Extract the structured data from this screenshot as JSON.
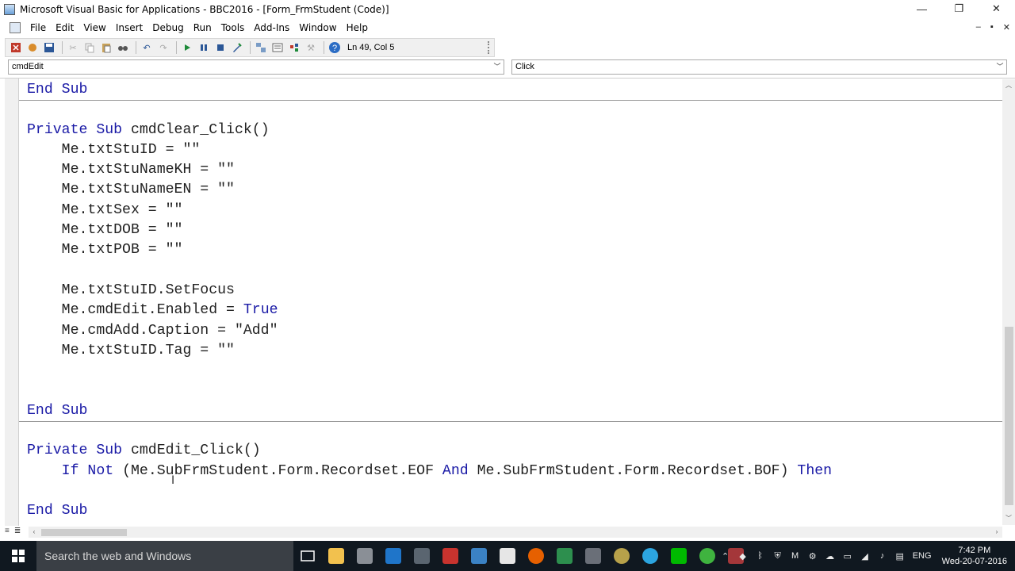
{
  "window": {
    "title": "Microsoft Visual Basic for Applications - BBC2016 - [Form_FrmStudent (Code)]",
    "minimize": "—",
    "restore": "❐",
    "close": "✕"
  },
  "menu": {
    "items": [
      "File",
      "Edit",
      "View",
      "Insert",
      "Debug",
      "Run",
      "Tools",
      "Add-Ins",
      "Window",
      "Help"
    ],
    "mdi": [
      "–",
      "▪",
      "✕"
    ]
  },
  "toolbar": {
    "status": "Ln 49, Col 5",
    "icons": [
      "excel-view-icon",
      "insert-module-icon",
      "save-icon",
      "cut-icon",
      "copy-icon",
      "paste-icon",
      "find-icon",
      "undo-icon",
      "redo-icon",
      "run-icon",
      "break-icon",
      "reset-icon",
      "design-mode-icon",
      "project-explorer-icon",
      "properties-icon",
      "object-browser-icon",
      "toolbox-icon",
      "help-icon"
    ]
  },
  "object_combo": {
    "value": "cmdEdit"
  },
  "procedure_combo": {
    "value": "Click"
  },
  "code_lines": [
    [
      {
        "t": "End Sub",
        "k": 1
      }
    ],
    [],
    [
      {
        "t": "Private Sub",
        "k": 1
      },
      {
        "t": " cmdClear_Click()",
        "k": 0
      }
    ],
    [
      {
        "t": "    Me.txtStuID = \"\"",
        "k": 0
      }
    ],
    [
      {
        "t": "    Me.txtStuNameKH = \"\"",
        "k": 0
      }
    ],
    [
      {
        "t": "    Me.txtStuNameEN = \"\"",
        "k": 0
      }
    ],
    [
      {
        "t": "    Me.txtSex = \"\"",
        "k": 0
      }
    ],
    [
      {
        "t": "    Me.txtDOB = \"\"",
        "k": 0
      }
    ],
    [
      {
        "t": "    Me.txtPOB = \"\"",
        "k": 0
      }
    ],
    [],
    [
      {
        "t": "    Me.txtStuID.SetFocus",
        "k": 0
      }
    ],
    [
      {
        "t": "    Me.cmdEdit.Enabled = ",
        "k": 0
      },
      {
        "t": "True",
        "k": 1
      }
    ],
    [
      {
        "t": "    Me.cmdAdd.Caption = \"Add\"",
        "k": 0
      }
    ],
    [
      {
        "t": "    Me.txtStuID.Tag = \"\"",
        "k": 0
      }
    ],
    [],
    [],
    [
      {
        "t": "End Sub",
        "k": 1
      }
    ],
    [],
    [
      {
        "t": "Private Sub",
        "k": 1
      },
      {
        "t": " cmdEdit_Click()",
        "k": 0
      }
    ],
    [
      {
        "t": "    ",
        "k": 0
      },
      {
        "t": "If Not",
        "k": 1
      },
      {
        "t": " (Me.SubFrmStudent.Form.Recordset.EOF ",
        "k": 0
      },
      {
        "t": "And",
        "k": 1
      },
      {
        "t": " Me.SubFrmStudent.Form.Recordset.BOF) ",
        "k": 0
      },
      {
        "t": "Then",
        "k": 1
      }
    ],
    [],
    [
      {
        "t": "End Sub",
        "k": 1
      }
    ]
  ],
  "taskbar": {
    "search_placeholder": "Search the web and Windows",
    "language": "ENG",
    "time": "7:42 PM",
    "date": "Wed-20-07-2016"
  },
  "colors": {
    "keyword": "#1a1aa6",
    "taskbar": "#101820"
  }
}
